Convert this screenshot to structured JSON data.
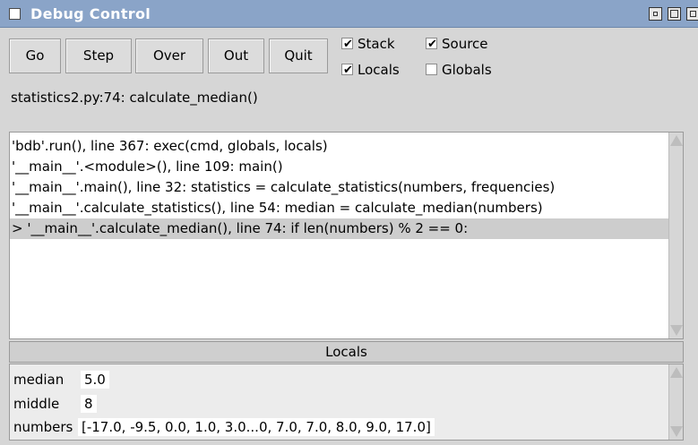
{
  "window": {
    "title": "Debug Control",
    "icons": [
      "window-menu-icon",
      "minimize-icon",
      "maximize-icon",
      "close-icon"
    ]
  },
  "toolbar": {
    "buttons": [
      {
        "label": "Go"
      },
      {
        "label": "Step"
      },
      {
        "label": "Over"
      },
      {
        "label": "Out"
      },
      {
        "label": "Quit"
      }
    ]
  },
  "options": {
    "stack": {
      "label": "Stack",
      "checked": true
    },
    "source": {
      "label": "Source",
      "checked": true
    },
    "locals": {
      "label": "Locals",
      "checked": true
    },
    "globals": {
      "label": "Globals",
      "checked": false
    },
    "check_glyph": "✔"
  },
  "status": {
    "text": "statistics2.py:74: calculate_median()"
  },
  "stack": {
    "lines": [
      "'bdb'.run(), line 367: exec(cmd, globals, locals)",
      "'__main__'.<module>(), line 109: main()",
      "'__main__'.main(), line 32: statistics = calculate_statistics(numbers, frequencies)",
      "'__main__'.calculate_statistics(), line 54: median = calculate_median(numbers)",
      "> '__main__'.calculate_median(), line 74: if len(numbers) % 2 == 0:"
    ],
    "selected_index": 4
  },
  "locals": {
    "header": "Locals",
    "vars": [
      {
        "name": "median",
        "value": "5.0"
      },
      {
        "name": "middle",
        "value": "8"
      },
      {
        "name": "numbers",
        "value": "[-17.0, -9.5, 0.0, 1.0, 3.0...0, 7.0, 7.0, 8.0, 9.0, 17.0]"
      }
    ]
  },
  "colors": {
    "titlebar": "#8aa4c8",
    "selection": "#cdcdcd",
    "window_bg": "#d6d6d6"
  }
}
